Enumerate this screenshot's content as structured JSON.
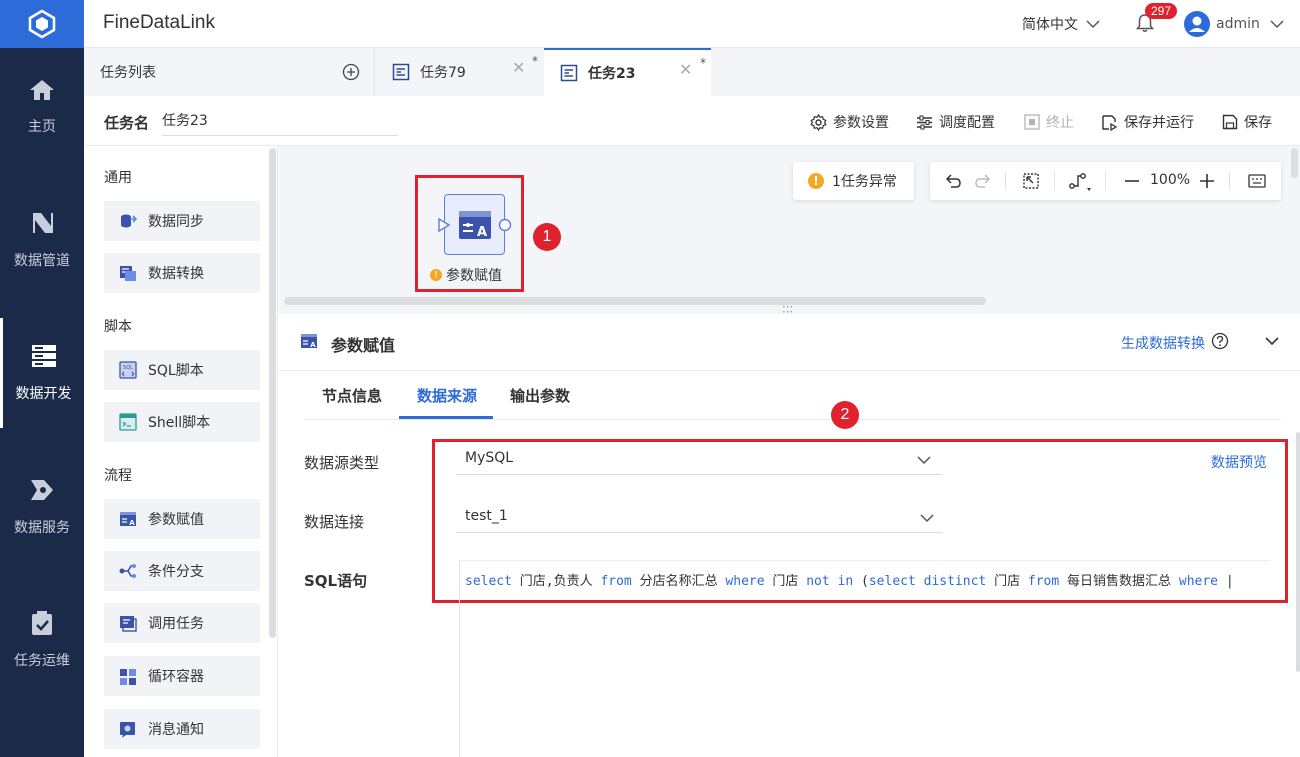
{
  "app": {
    "title": "FineDataLink",
    "language": "简体中文",
    "user": "admin",
    "notifications": "297"
  },
  "nav": [
    {
      "label": "主页",
      "icon": "home-icon"
    },
    {
      "label": "数据管道",
      "icon": "pipeline-icon"
    },
    {
      "label": "数据开发",
      "icon": "dev-icon",
      "active": true
    },
    {
      "label": "数据服务",
      "icon": "service-icon"
    },
    {
      "label": "任务运维",
      "icon": "ops-icon"
    }
  ],
  "tabs": {
    "list_label": "任务列表",
    "items": [
      {
        "label": "任务79",
        "mark": "*"
      },
      {
        "label": "任务23",
        "mark": "*",
        "active": true
      }
    ]
  },
  "task": {
    "name_label": "任务名",
    "name_value": "任务23"
  },
  "toolbar": {
    "param_settings": "参数设置",
    "schedule_config": "调度配置",
    "terminate": "终止",
    "save_run": "保存并运行",
    "save": "保存"
  },
  "palette": {
    "sections": [
      {
        "title": "通用",
        "items": [
          "数据同步",
          "数据转换"
        ]
      },
      {
        "title": "脚本",
        "items": [
          "SQL脚本",
          "Shell脚本"
        ]
      },
      {
        "title": "流程",
        "items": [
          "参数赋值",
          "条件分支",
          "调用任务",
          "循环容器",
          "消息通知"
        ]
      }
    ]
  },
  "canvas": {
    "node_label": "参数赋值",
    "error_badge": "1任务异常",
    "zoom": "100%",
    "callout1": "1",
    "callout2": "2"
  },
  "panel": {
    "title": "参数赋值",
    "generate_link": "生成数据转换",
    "tabs": [
      "节点信息",
      "数据来源",
      "输出参数"
    ],
    "active_tab": "数据来源",
    "fields": {
      "source_type_label": "数据源类型",
      "source_type_value": "MySQL",
      "preview_link": "数据预览",
      "connection_label": "数据连接",
      "connection_value": "test_1",
      "sql_label": "SQL语句"
    },
    "sql_tokens": [
      {
        "t": "select",
        "kw": true
      },
      {
        "t": " 门店,负责人 ",
        "kw": false
      },
      {
        "t": "from",
        "kw": true
      },
      {
        "t": " 分店名称汇总 ",
        "kw": false
      },
      {
        "t": "where",
        "kw": true
      },
      {
        "t": " 门店 ",
        "kw": false
      },
      {
        "t": "not in",
        "kw": true
      },
      {
        "t": " (",
        "kw": false
      },
      {
        "t": "select distinct",
        "kw": true
      },
      {
        "t": " 门店 ",
        "kw": false
      },
      {
        "t": "from",
        "kw": true
      },
      {
        "t": " 每日销售数据汇总 ",
        "kw": false
      },
      {
        "t": "where",
        "kw": true
      },
      {
        "t": " |",
        "kw": false
      }
    ]
  },
  "colors": {
    "accent": "#2d6bd8",
    "nav_bg": "#1c2a4a",
    "highlight": "#e0222e",
    "warning": "#f5a623"
  }
}
